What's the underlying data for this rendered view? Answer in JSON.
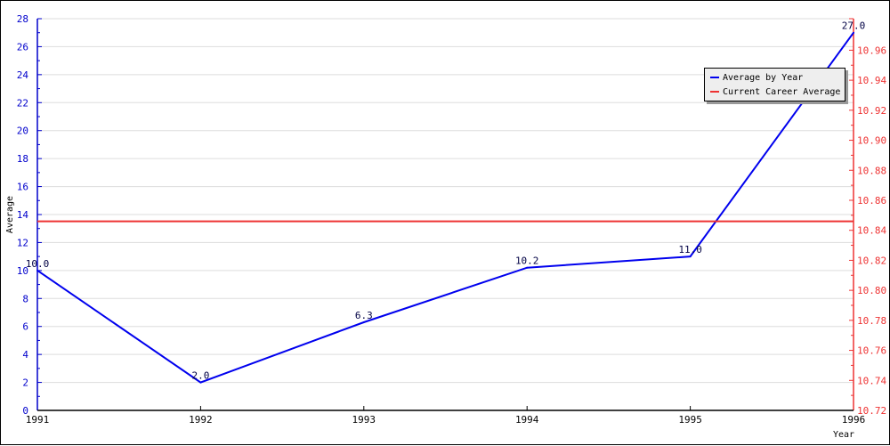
{
  "chart_data": {
    "type": "line",
    "title": "",
    "xlabel": "Year",
    "ylabel": "Average",
    "categories": [
      "1991",
      "1992",
      "1993",
      "1994",
      "1995",
      "1996"
    ],
    "series": [
      {
        "name": "Average by Year",
        "axis": "left",
        "color": "#0000ee",
        "values": [
          10.0,
          2.0,
          6.3,
          10.2,
          11.0,
          27.0
        ],
        "data_labels": [
          "10.0",
          "2.0",
          "6.3",
          "10.2",
          "11.0",
          "27.0"
        ]
      },
      {
        "name": "Current Career Average",
        "axis": "right",
        "color": "#ee3333",
        "values": [
          10.846,
          10.846,
          10.846,
          10.846,
          10.846,
          10.846
        ]
      }
    ],
    "left_axis": {
      "range": [
        0,
        28
      ],
      "ticks": [
        "0",
        "2",
        "4",
        "6",
        "8",
        "10",
        "12",
        "14",
        "16",
        "18",
        "20",
        "22",
        "24",
        "26",
        "28"
      ],
      "color": "#0000cc"
    },
    "right_axis": {
      "range": [
        10.72,
        10.981
      ],
      "ticks": [
        "10.72",
        "10.74",
        "10.76",
        "10.78",
        "10.80",
        "10.82",
        "10.84",
        "10.86",
        "10.88",
        "10.90",
        "10.92",
        "10.94",
        "10.96"
      ],
      "color": "#ee3333"
    },
    "grid": true,
    "legend_position": "top-right",
    "legend": [
      "Average by Year",
      "Current Career Average"
    ]
  }
}
